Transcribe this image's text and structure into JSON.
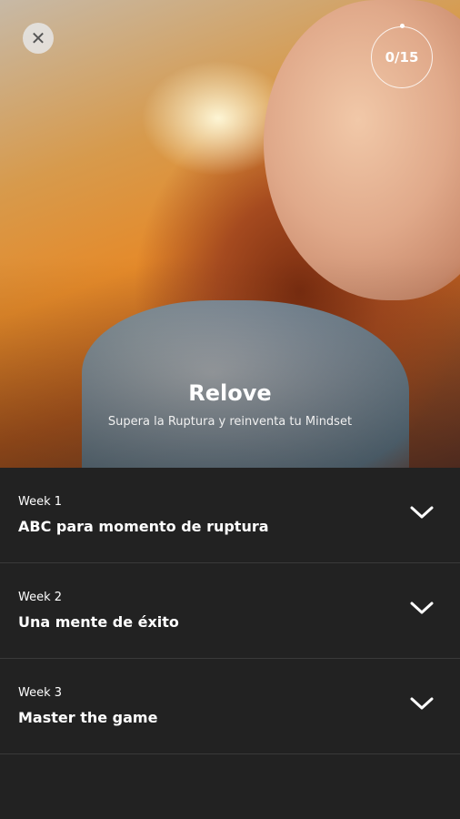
{
  "header": {
    "close_icon": "close-icon",
    "progress_text": "0/15",
    "title": "Relove",
    "subtitle": "Supera la Ruptura y reinventa tu Mindset"
  },
  "weeks": [
    {
      "label": "Week 1",
      "title": "ABC para momento de ruptura"
    },
    {
      "label": "Week 2",
      "title": "Una mente de éxito"
    },
    {
      "label": "Week 3",
      "title": "Master the game"
    }
  ]
}
